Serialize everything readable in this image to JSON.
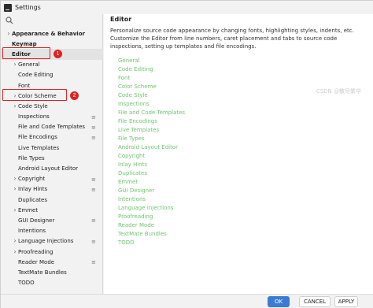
{
  "window": {
    "title": "Settings"
  },
  "left_panel": {
    "tree": [
      {
        "label": "Appearance & Behavior",
        "level": 0,
        "bold": true,
        "caret": "›"
      },
      {
        "label": "Keymap",
        "level": 0,
        "bold": true
      },
      {
        "label": "Editor",
        "level": 0,
        "bold": true,
        "selected": true
      },
      {
        "label": "General",
        "level": 1,
        "caret": "›"
      },
      {
        "label": "Code Editing",
        "level": 1
      },
      {
        "label": "Font",
        "level": 1
      },
      {
        "label": "Color Scheme",
        "level": 1,
        "caret": "›"
      },
      {
        "label": "Code Style",
        "level": 1,
        "caret": "›"
      },
      {
        "label": "Inspections",
        "level": 1,
        "icon": true
      },
      {
        "label": "File and Code Templates",
        "level": 1,
        "icon": true
      },
      {
        "label": "File Encodings",
        "level": 1,
        "icon": true
      },
      {
        "label": "Live Templates",
        "level": 1
      },
      {
        "label": "File Types",
        "level": 1
      },
      {
        "label": "Android Layout Editor",
        "level": 1
      },
      {
        "label": "Copyright",
        "level": 1,
        "caret": "›",
        "icon": true
      },
      {
        "label": "Inlay Hints",
        "level": 1,
        "caret": "›",
        "icon": true
      },
      {
        "label": "Duplicates",
        "level": 1
      },
      {
        "label": "Emmet",
        "level": 1,
        "caret": "›"
      },
      {
        "label": "GUI Designer",
        "level": 1,
        "icon": true
      },
      {
        "label": "Intentions",
        "level": 1
      },
      {
        "label": "Language Injections",
        "level": 1,
        "caret": "›",
        "icon": true
      },
      {
        "label": "Proofreading",
        "level": 1,
        "caret": "›"
      },
      {
        "label": "Reader Mode",
        "level": 1,
        "icon": true
      },
      {
        "label": "TextMate Bundles",
        "level": 1
      },
      {
        "label": "TODO",
        "level": 1
      }
    ],
    "callouts": {
      "editor_badge": "1",
      "color_scheme_badge": "2",
      "color": "#dd2222"
    }
  },
  "content": {
    "heading": "Editor",
    "description": "Personalize source code appearance by changing fonts, highlighting styles, indents, etc. Customize the Editor from line numbers, caret placement and tabs to source code inspections, setting up templates and file encodings.",
    "links": [
      "General",
      "Code Editing",
      "Font",
      "Color Scheme",
      "Code Style",
      "Inspections",
      "File and Code Templates",
      "File Encodings",
      "Live Templates",
      "File Types",
      "Android Layout Editor",
      "Copyright",
      "Inlay Hints",
      "Duplicates",
      "Emmet",
      "GUI Designer",
      "Intentions",
      "Language Injections",
      "Proofreading",
      "Reader Mode",
      "TextMate Bundles",
      "TODO"
    ],
    "link_color": "#6fc56f"
  },
  "footer": {
    "ok_label": "OK",
    "cancel_label": "CANCEL",
    "apply_label": "APPLY",
    "accent": "#3a7bd5"
  },
  "watermark": "CSDN @散尽繁华"
}
